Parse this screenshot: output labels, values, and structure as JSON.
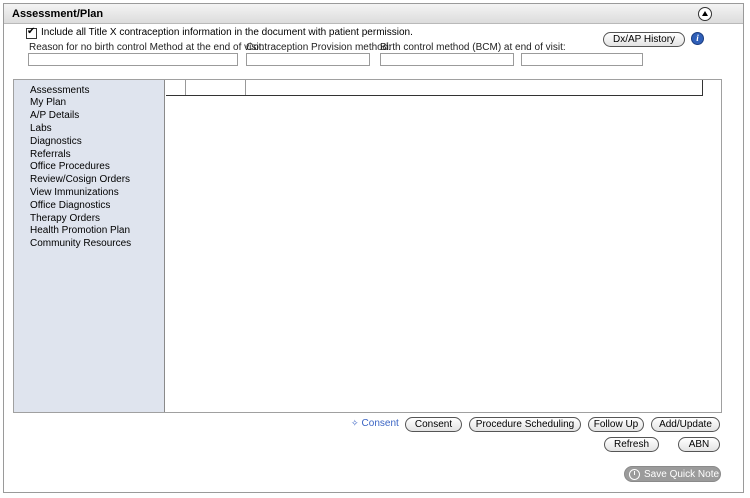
{
  "panel": {
    "title": "Assessment/Plan"
  },
  "title_x": {
    "checked": true,
    "label": "Include all Title X contraception information in the document with patient permission."
  },
  "fields": [
    {
      "label": "Reason for no birth control Method at the end of visit:",
      "value": ""
    },
    {
      "label": "Contraception Provision method:",
      "value": ""
    },
    {
      "label": "Birth control method (BCM) at end of visit:",
      "value": ""
    },
    {
      "label": "",
      "value": ""
    }
  ],
  "header_actions": {
    "dx_ap_history": "Dx/AP History",
    "info_icon": "i"
  },
  "nav": {
    "items": [
      "Assessments",
      "My Plan",
      "A/P Details",
      "Labs",
      "Diagnostics",
      "Referrals",
      "Office Procedures",
      "Review/Cosign Orders",
      "View Immunizations",
      "Office Diagnostics",
      "Therapy Orders",
      "Health Promotion Plan",
      "Community Resources"
    ]
  },
  "footer": {
    "consent_link": "Consent",
    "consent_link_icon": "✧",
    "buttons": {
      "consent": "Consent",
      "procedure_scheduling": "Procedure Scheduling",
      "follow_up": "Follow Up",
      "add_update": "Add/Update",
      "refresh": "Refresh",
      "abn": "ABN"
    },
    "save_quick_note": "Save Quick Note"
  }
}
